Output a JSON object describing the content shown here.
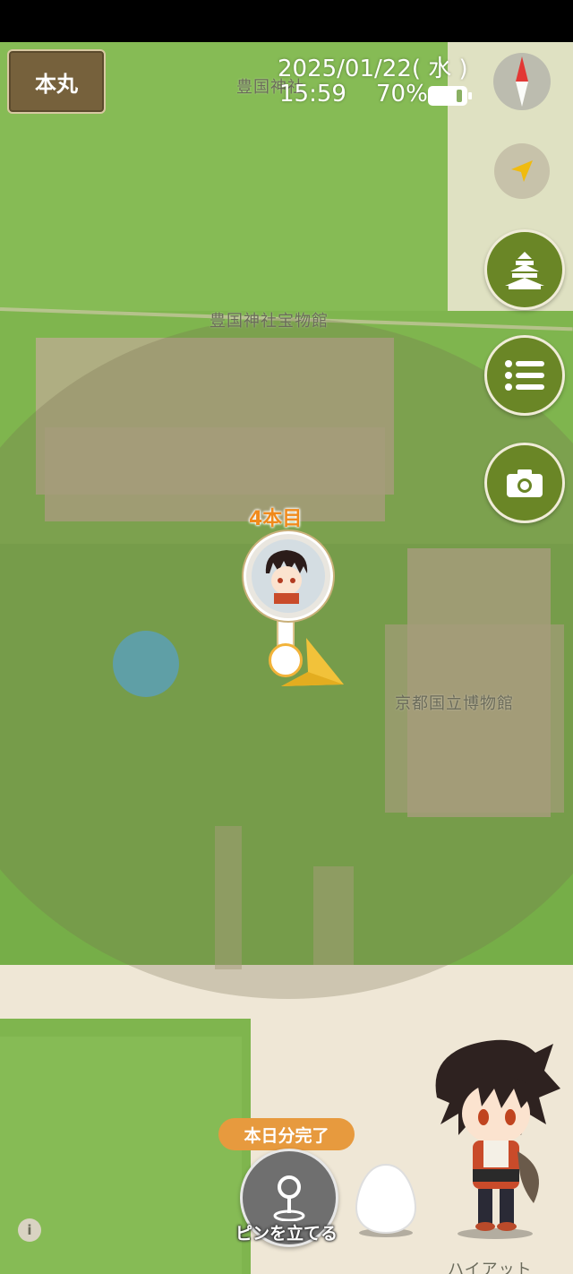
{
  "header": {
    "honmaru_label": "本丸",
    "date": "2025/01/22( 水 )",
    "time": "15:59",
    "battery": "70%"
  },
  "map": {
    "labels": {
      "shrine": "豊国神社",
      "treasure_hall": "豊国神社宝物館",
      "museum": "京都国立博物館",
      "hyatt": "ハイアット"
    },
    "colors": {
      "grass": "#7fb54e",
      "road": "#efe7d6",
      "building": "#b7ad8c",
      "pond": "#5f9fa6"
    }
  },
  "marker": {
    "count_label": "4本目"
  },
  "side_buttons": {
    "compass_icon": "compass-icon",
    "locate_icon": "location-arrow-icon",
    "castle_icon": "castle-icon",
    "list_icon": "list-icon",
    "camera_icon": "camera-icon",
    "accent": "#6a8626"
  },
  "bottom": {
    "done_badge": "本日分完了",
    "pin_button_label": "ピンを立てる",
    "info_label": "i"
  }
}
